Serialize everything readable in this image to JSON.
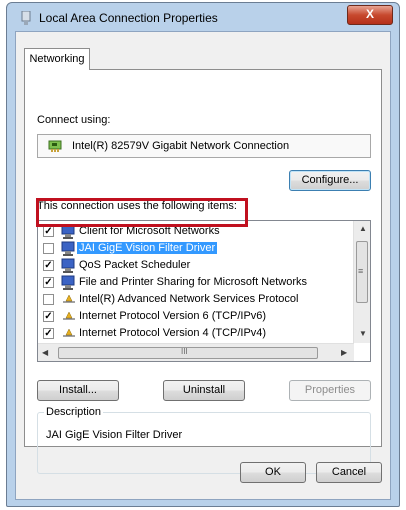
{
  "window": {
    "title": "Local Area Connection Properties",
    "close_glyph": "X"
  },
  "tabs": [
    {
      "label": "Networking"
    }
  ],
  "connect_using": {
    "label": "Connect using:",
    "adapter": "Intel(R) 82579V Gigabit Network Connection",
    "configure_label": "Configure..."
  },
  "items_heading": "This connection uses the following items:",
  "items": [
    {
      "label": "Client for Microsoft Networks",
      "checked": true,
      "icon": "network-client-icon"
    },
    {
      "label": "JAI GigE Vision Filter Driver",
      "checked": false,
      "icon": "filter-driver-icon",
      "selected": true
    },
    {
      "label": "QoS Packet Scheduler",
      "checked": true,
      "icon": "qos-scheduler-icon"
    },
    {
      "label": "File and Printer Sharing for Microsoft Networks",
      "checked": true,
      "icon": "file-sharing-icon"
    },
    {
      "label": "Intel(R) Advanced Network Services Protocol",
      "checked": false,
      "icon": "protocol-icon"
    },
    {
      "label": "Internet Protocol Version 6 (TCP/IPv6)",
      "checked": true,
      "icon": "protocol-icon"
    },
    {
      "label": "Internet Protocol Version 4 (TCP/IPv4)",
      "checked": true,
      "icon": "protocol-icon"
    }
  ],
  "scroll": {
    "hthumb_glyph": "III",
    "vthumb_glyph": "≡"
  },
  "buttons": {
    "install": "Install...",
    "uninstall": "Uninstall",
    "properties": "Properties",
    "ok": "OK",
    "cancel": "Cancel"
  },
  "description": {
    "legend": "Description",
    "text": "JAI GigE Vision Filter Driver"
  },
  "colors": {
    "selection": "#3399ff",
    "highlight_box": "#c0101f"
  }
}
